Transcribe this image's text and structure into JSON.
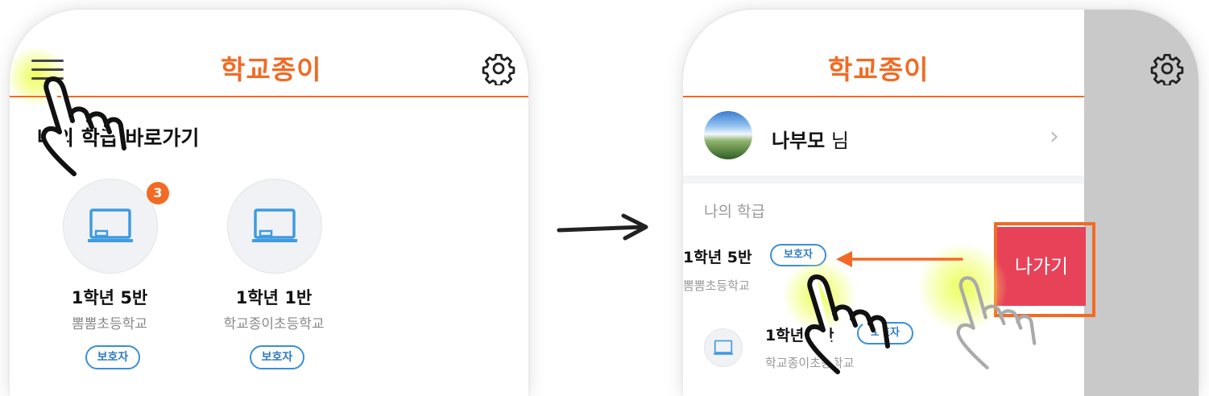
{
  "left": {
    "header": {
      "title": "학교종이"
    },
    "shortcut_title": "나의 학급 바로가기",
    "classes": [
      {
        "name": "1학년 5반",
        "school": "뽐뽐초등학교",
        "role": "보호자",
        "badge": "3"
      },
      {
        "name": "1학년 1반",
        "school": "학교종이초등학교",
        "role": "보호자"
      }
    ]
  },
  "right": {
    "header": {
      "title": "학교종이"
    },
    "profile": {
      "name": "나부모",
      "suffix": "님"
    },
    "my_classes_label": "나의 학급",
    "classes": [
      {
        "name": "1학년 5반",
        "school": "뽐뽐초등학교",
        "role": "보호자"
      },
      {
        "name": "1학년 1반",
        "school": "학교종이초등학교",
        "role": "보호자"
      }
    ],
    "leave_label": "나가기"
  },
  "colors": {
    "brand": "#f26a24",
    "pill": "#3a8fd8",
    "leave": "#e84259",
    "highlight": "#ecff50",
    "shade": "#c9c9c9"
  },
  "icons": [
    "menu-icon",
    "settings-gear-icon",
    "classroom-board-icon",
    "chevron-right-icon",
    "arrow-right-icon",
    "arrow-left-icon",
    "hand-pointer-icon"
  ]
}
